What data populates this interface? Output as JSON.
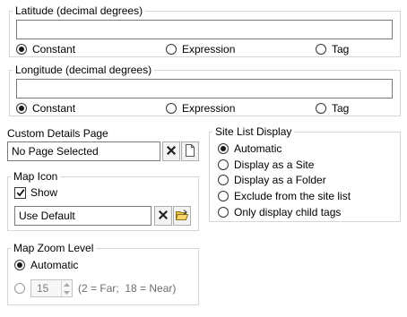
{
  "latitude": {
    "legend": "Latitude (decimal degrees)",
    "value": "",
    "options": [
      "Constant",
      "Expression",
      "Tag"
    ],
    "selected": "Constant"
  },
  "longitude": {
    "legend": "Longitude (decimal degrees)",
    "value": "",
    "options": [
      "Constant",
      "Expression",
      "Tag"
    ],
    "selected": "Constant"
  },
  "details_page": {
    "label": "Custom Details Page",
    "value": "No Page Selected",
    "clear_icon": "close-icon",
    "browse_icon": "page-icon"
  },
  "map_icon": {
    "legend": "Map Icon",
    "show_label": "Show",
    "show_checked": true,
    "value": "Use Default",
    "clear_icon": "close-icon",
    "browse_icon": "folder-open-icon"
  },
  "site_list": {
    "legend": "Site List Display",
    "options": [
      "Automatic",
      "Display as a Site",
      "Display as a Folder",
      "Exclude from the site list",
      "Only display child tags"
    ],
    "selected": "Automatic"
  },
  "zoom": {
    "legend": "Map Zoom Level",
    "automatic_label": "Automatic",
    "automatic_selected": true,
    "value": "15",
    "hint": "(2 = Far;  18 = Near)"
  }
}
